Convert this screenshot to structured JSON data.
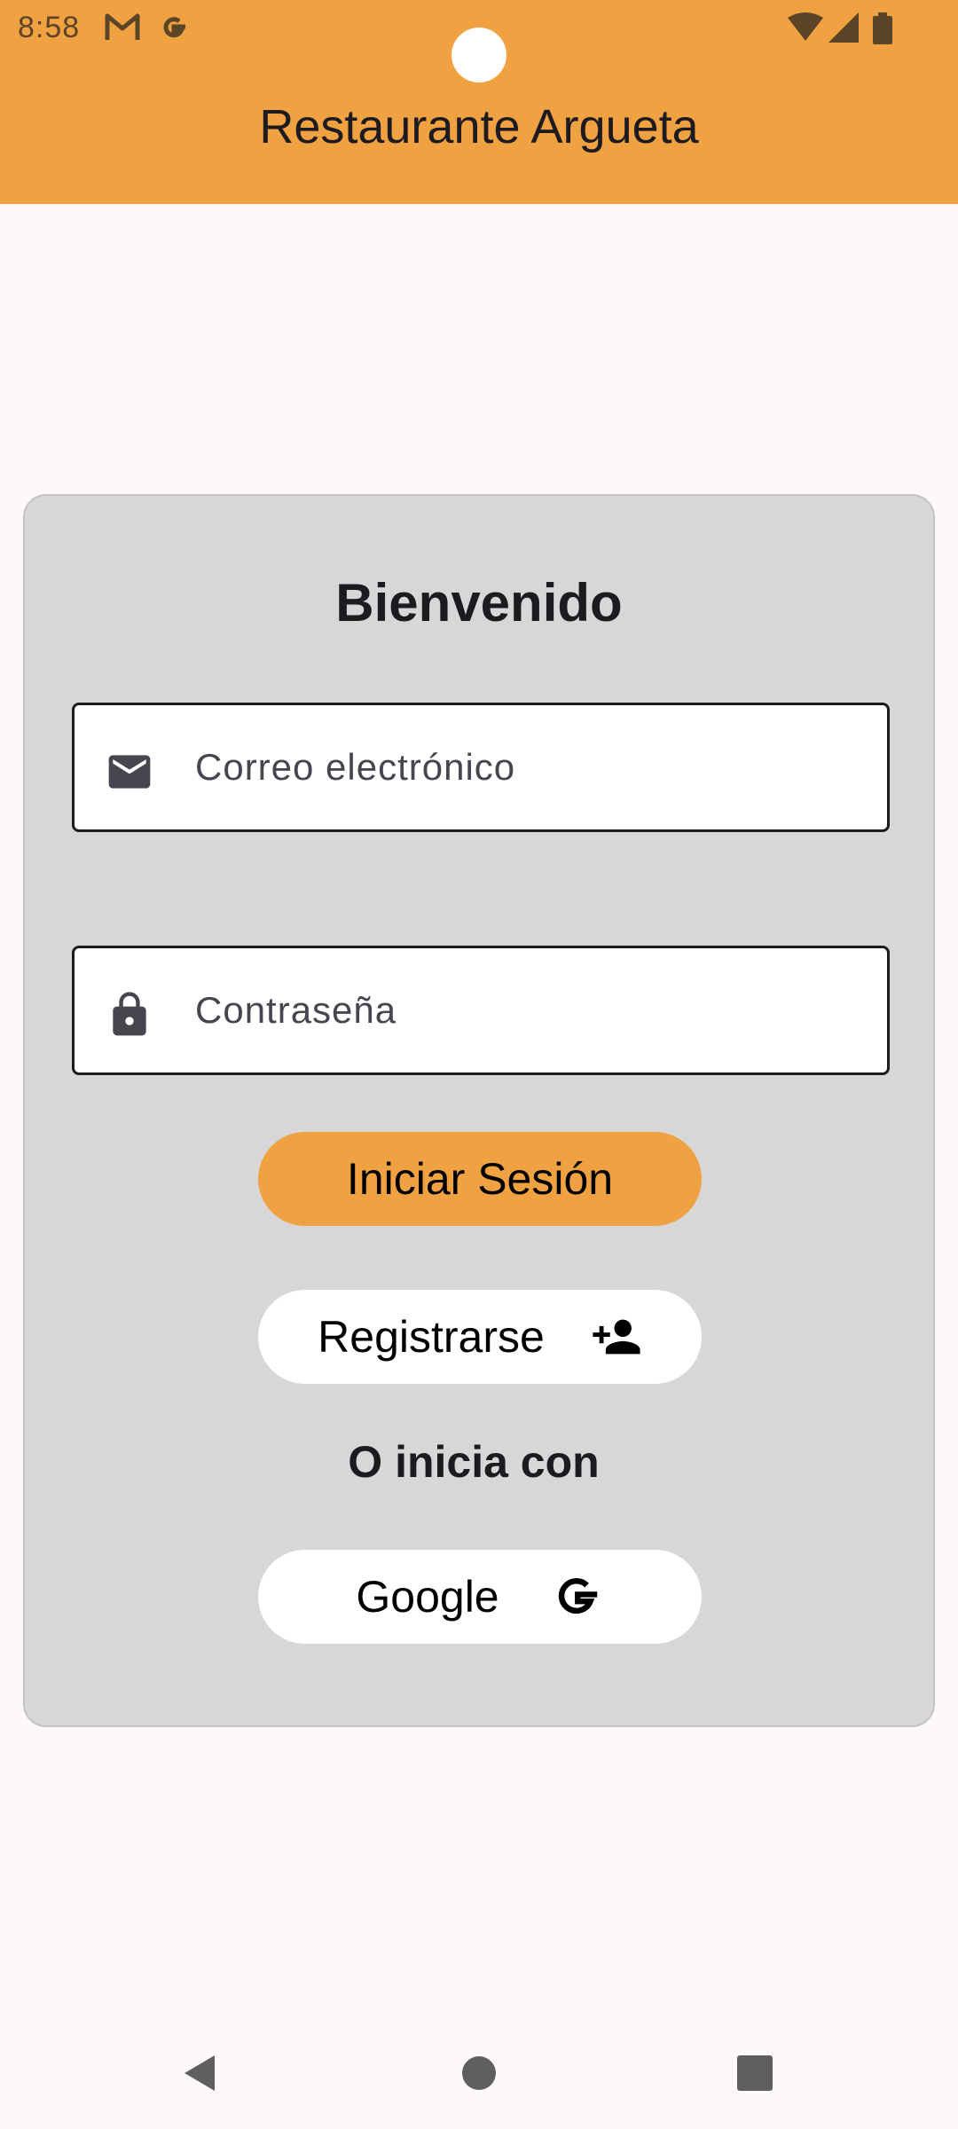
{
  "status_bar": {
    "time": "8:58",
    "notification_icons": [
      "gmail-icon",
      "google-icon"
    ],
    "system_icons": [
      "wifi-icon",
      "cell-signal-icon",
      "battery-icon"
    ]
  },
  "app_bar": {
    "title": "Restaurante Argueta",
    "color": "#f0a242"
  },
  "login_card": {
    "heading": "Bienvenido",
    "email": {
      "placeholder": "Correo electrónico",
      "value": "",
      "icon": "mail-icon"
    },
    "password": {
      "placeholder": "Contraseña",
      "value": "",
      "icon": "lock-icon"
    },
    "login_button": {
      "label": "Iniciar Sesión",
      "color": "#f0a242"
    },
    "register_button": {
      "label": "Registrarse",
      "icon": "person-add-icon"
    },
    "alt_login_text": "O inicia con",
    "google_button": {
      "label": "Google",
      "icon": "google-g-icon"
    }
  },
  "nav_bar": {
    "buttons": [
      "back-icon",
      "home-icon",
      "recents-icon"
    ]
  }
}
